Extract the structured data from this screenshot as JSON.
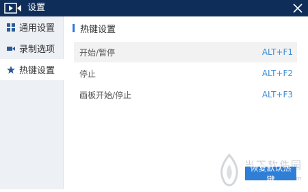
{
  "window": {
    "title": "设置"
  },
  "sidebar": {
    "items": [
      {
        "label": "通用设置",
        "icon": "grid-icon",
        "active": false
      },
      {
        "label": "录制选项",
        "icon": "camera-icon",
        "active": false
      },
      {
        "label": "热键设置",
        "icon": "star-icon",
        "active": true
      }
    ]
  },
  "main": {
    "section_title": "热键设置",
    "hotkeys": [
      {
        "action": "开始/暂停",
        "key": "ALT+F1"
      },
      {
        "action": "停止",
        "key": "ALT+F2"
      },
      {
        "action": "画板开始/停止",
        "key": "ALT+F3"
      }
    ],
    "restore_button": "恢复默认热键"
  },
  "watermark": {
    "text": "当下软件园",
    "sub": "www.downxia.com"
  },
  "colors": {
    "titlebar": "#0f2d59",
    "accent": "#2f7fd7",
    "key_text": "#3e8ed8",
    "sidebar_bg": "#edf0f4"
  }
}
